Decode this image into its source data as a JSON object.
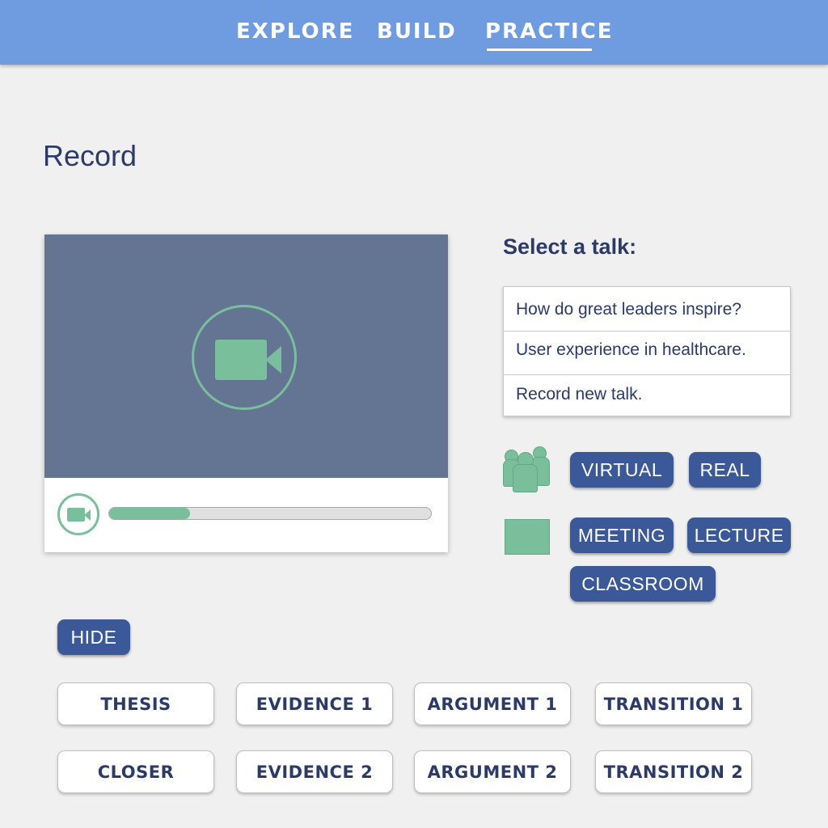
{
  "nav": {
    "explore": "EXPLORE",
    "build": "BUILD",
    "practice": "PRACTICE",
    "active": "PRACTICE"
  },
  "page": {
    "title": "Record"
  },
  "video": {
    "progress_fraction": 0.25
  },
  "talks": {
    "heading": "Select a talk:",
    "items": [
      "How do great leaders inspire?",
      "User experience in healthcare.",
      "Record new talk."
    ]
  },
  "audience": {
    "options": [
      "VIRTUAL",
      "REAL"
    ]
  },
  "venue": {
    "options": [
      "MEETING",
      "LECTURE",
      "CLASSROOM"
    ]
  },
  "hide_label": "HIDE",
  "structure": {
    "row1": [
      "THESIS",
      "EVIDENCE 1",
      "ARGUMENT 1",
      "TRANSITION 1"
    ],
    "row2": [
      "CLOSER",
      "EVIDENCE 2",
      "ARGUMENT 2",
      "TRANSITION 2"
    ]
  },
  "colors": {
    "nav_bg": "#6f9be0",
    "accent_green": "#79bf9c",
    "button_blue": "#3b5899",
    "text_navy": "#2b3a67",
    "video_bg": "#647594"
  },
  "icons": {
    "camera": "video-camera-icon",
    "audience": "people-icon",
    "venue": "room-icon"
  }
}
